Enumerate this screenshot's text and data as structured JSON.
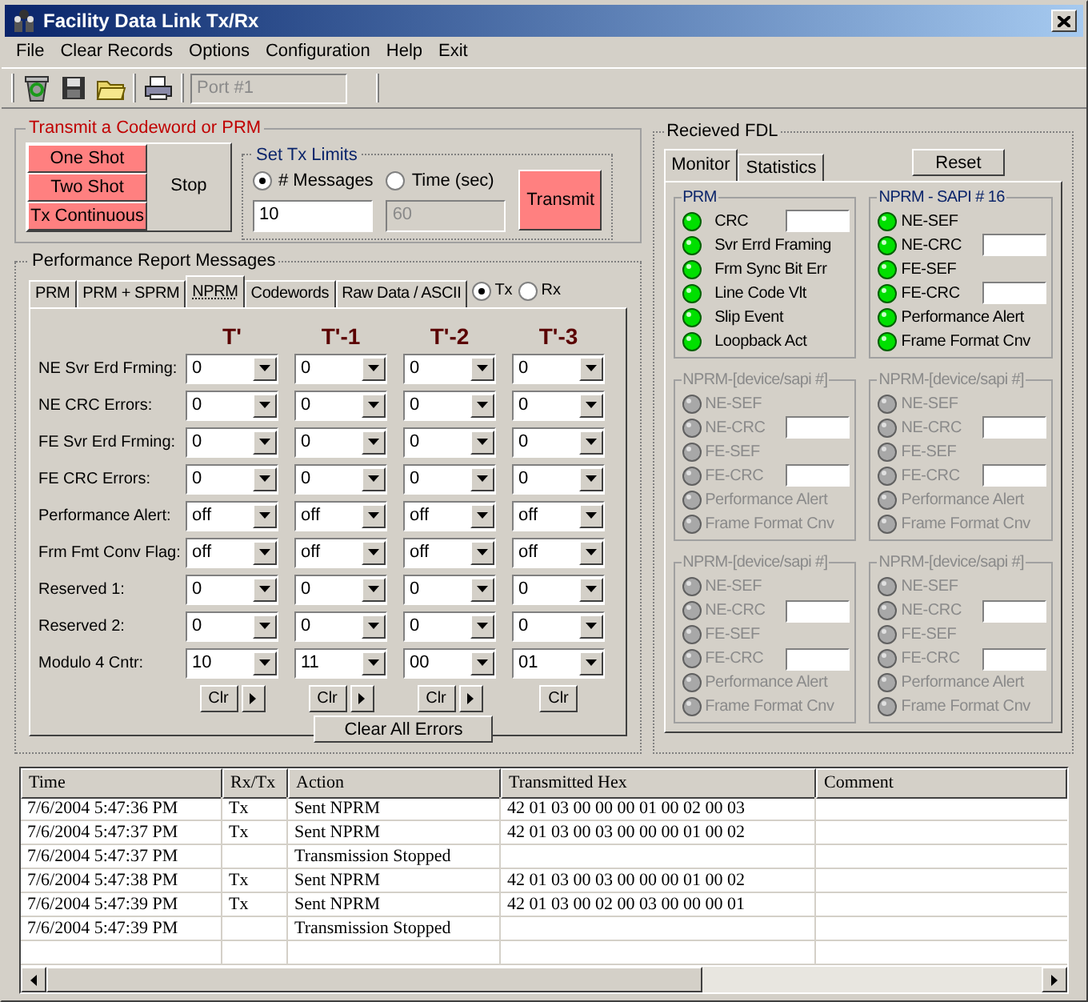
{
  "window": {
    "title": "Facility Data Link Tx/Rx"
  },
  "menu": [
    "File",
    "Clear Records",
    "Options",
    "Configuration",
    "Help",
    "Exit"
  ],
  "toolbar": {
    "port": "Port #1",
    "port_disabled": true
  },
  "transmit": {
    "title": "Transmit a Codeword or PRM",
    "buttons": [
      "One Shot",
      "Two Shot",
      "Tx Continuous"
    ],
    "stop": "Stop"
  },
  "tx_limits": {
    "title": "Set Tx Limits",
    "options": [
      {
        "label": "# Messages",
        "selected": true,
        "value": "10"
      },
      {
        "label": "Time (sec)",
        "selected": false,
        "value": "60"
      }
    ],
    "transmit": "Transmit"
  },
  "performance": {
    "title": "Performance Report  Messages",
    "tabs": [
      {
        "label": "PRM",
        "selected": false
      },
      {
        "label": "PRM + SPRM",
        "selected": false
      },
      {
        "label": "NPRM",
        "selected": true
      },
      {
        "label": "Codewords",
        "selected": false
      },
      {
        "label": "Raw Data / ASCII",
        "selected": false
      }
    ],
    "direction": [
      {
        "label": "Tx",
        "selected": true
      },
      {
        "label": "Rx",
        "selected": false
      }
    ],
    "columns": [
      "T'",
      "T'-1",
      "T'-2",
      "T'-3"
    ],
    "rows": [
      {
        "label": "NE Svr Erd Frming:",
        "values": [
          "0",
          "0",
          "0",
          "0"
        ]
      },
      {
        "label": "NE CRC Errors:",
        "values": [
          "0",
          "0",
          "0",
          "0"
        ]
      },
      {
        "label": "FE Svr Erd Frming:",
        "values": [
          "0",
          "0",
          "0",
          "0"
        ]
      },
      {
        "label": "FE CRC Errors:",
        "values": [
          "0",
          "0",
          "0",
          "0"
        ]
      },
      {
        "label": "Performance Alert:",
        "values": [
          "off",
          "off",
          "off",
          "off"
        ]
      },
      {
        "label": "Frm Fmt Conv Flag:",
        "values": [
          "off",
          "off",
          "off",
          "off"
        ]
      },
      {
        "label": "Reserved 1:",
        "values": [
          "0",
          "0",
          "0",
          "0"
        ]
      },
      {
        "label": "Reserved 2:",
        "values": [
          "0",
          "0",
          "0",
          "0"
        ]
      },
      {
        "label": "Modulo 4 Cntr:",
        "values": [
          "10",
          "11",
          "00",
          "01"
        ]
      }
    ],
    "column_buttons": [
      {
        "clear": "Clr",
        "has_next": true
      },
      {
        "clear": "Clr",
        "has_next": true
      },
      {
        "clear": "Clr",
        "has_next": true
      },
      {
        "clear": "Clr",
        "has_next": false
      }
    ],
    "clear_all": "Clear All Errors"
  },
  "received": {
    "title": "Recieved FDL",
    "tabs": [
      {
        "label": "Monitor",
        "selected": true
      },
      {
        "label": "Statistics",
        "selected": false
      }
    ],
    "reset": "Reset",
    "groups": [
      {
        "title": "PRM",
        "enabled": true,
        "items": [
          {
            "label": "CRC",
            "on": true,
            "kind": "counter"
          },
          {
            "label": "Svr Errd Framing",
            "on": true,
            "kind": "plain"
          },
          {
            "label": "Frm Sync Bit Err",
            "on": true,
            "kind": "plain"
          },
          {
            "label": "Line Code Vlt",
            "on": true,
            "kind": "plain"
          },
          {
            "label": "Slip Event",
            "on": true,
            "kind": "plain"
          },
          {
            "label": "Loopback Act",
            "on": true,
            "kind": "plain"
          }
        ]
      },
      {
        "title": "NPRM - SAPI # 16",
        "enabled": true,
        "items": [
          {
            "label": "NE-SEF",
            "on": true,
            "kind": "plain"
          },
          {
            "label": "NE-CRC",
            "on": true,
            "kind": "counter"
          },
          {
            "label": "FE-SEF",
            "on": true,
            "kind": "plain"
          },
          {
            "label": "FE-CRC",
            "on": true,
            "kind": "counter"
          },
          {
            "label": "Performance Alert",
            "on": true,
            "kind": "plain"
          },
          {
            "label": "Frame Format Cnv",
            "on": true,
            "kind": "plain"
          }
        ]
      },
      {
        "title": "NPRM-[device/sapi #]",
        "enabled": false,
        "items": [
          {
            "label": "NE-SEF",
            "on": false,
            "kind": "plain"
          },
          {
            "label": "NE-CRC",
            "on": false,
            "kind": "counter"
          },
          {
            "label": "FE-SEF",
            "on": false,
            "kind": "plain"
          },
          {
            "label": "FE-CRC",
            "on": false,
            "kind": "counter"
          },
          {
            "label": "Performance Alert",
            "on": false,
            "kind": "plain"
          },
          {
            "label": "Frame Format Cnv",
            "on": false,
            "kind": "plain"
          }
        ]
      },
      {
        "title": "NPRM-[device/sapi #]",
        "enabled": false,
        "items": [
          {
            "label": "NE-SEF",
            "on": false,
            "kind": "plain"
          },
          {
            "label": "NE-CRC",
            "on": false,
            "kind": "counter"
          },
          {
            "label": "FE-SEF",
            "on": false,
            "kind": "plain"
          },
          {
            "label": "FE-CRC",
            "on": false,
            "kind": "counter"
          },
          {
            "label": "Performance Alert",
            "on": false,
            "kind": "plain"
          },
          {
            "label": "Frame Format Cnv",
            "on": false,
            "kind": "plain"
          }
        ]
      },
      {
        "title": "NPRM-[device/sapi #]",
        "enabled": false,
        "items": [
          {
            "label": "NE-SEF",
            "on": false,
            "kind": "plain"
          },
          {
            "label": "NE-CRC",
            "on": false,
            "kind": "counter"
          },
          {
            "label": "FE-SEF",
            "on": false,
            "kind": "plain"
          },
          {
            "label": "FE-CRC",
            "on": false,
            "kind": "counter"
          },
          {
            "label": "Performance Alert",
            "on": false,
            "kind": "plain"
          },
          {
            "label": "Frame Format Cnv",
            "on": false,
            "kind": "plain"
          }
        ]
      },
      {
        "title": "NPRM-[device/sapi #]",
        "enabled": false,
        "items": [
          {
            "label": "NE-SEF",
            "on": false,
            "kind": "plain"
          },
          {
            "label": "NE-CRC",
            "on": false,
            "kind": "counter"
          },
          {
            "label": "FE-SEF",
            "on": false,
            "kind": "plain"
          },
          {
            "label": "FE-CRC",
            "on": false,
            "kind": "counter"
          },
          {
            "label": "Performance Alert",
            "on": false,
            "kind": "plain"
          },
          {
            "label": "Frame Format Cnv",
            "on": false,
            "kind": "plain"
          }
        ]
      }
    ]
  },
  "log": {
    "columns": [
      "Time",
      "Rx/Tx",
      "Action",
      "Transmitted Hex",
      "Comment"
    ],
    "rows": [
      {
        "time": "7/6/2004 5:47:36 PM",
        "rx_tx": "Tx",
        "action": "Sent NPRM",
        "hex": "42 01 03 00 00 00 01 00 02 00 03"
      },
      {
        "time": "7/6/2004 5:47:37 PM",
        "rx_tx": "Tx",
        "action": "Sent NPRM",
        "hex": "42 01 03 00 03 00 00 00 01 00 02"
      },
      {
        "time": "7/6/2004 5:47:37 PM",
        "action": "Transmission Stopped"
      },
      {
        "time": "7/6/2004 5:47:38 PM",
        "rx_tx": "Tx",
        "action": "Sent NPRM",
        "hex": "42 01 03 00 03 00 00 00 01 00 02"
      },
      {
        "time": "7/6/2004 5:47:39 PM",
        "rx_tx": "Tx",
        "action": "Sent NPRM",
        "hex": "42 01 03 00 02 00 03 00 00 00 01"
      },
      {
        "time": "7/6/2004 5:47:39 PM",
        "action": "Transmission Stopped"
      }
    ]
  }
}
